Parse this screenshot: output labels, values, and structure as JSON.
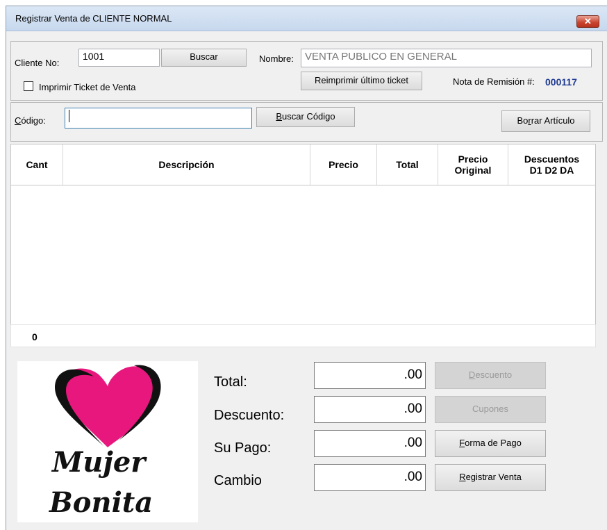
{
  "window": {
    "title": "Registrar Venta de CLIENTE NORMAL",
    "close_symbol": "✕"
  },
  "customer": {
    "client_no_label": "Cliente No:",
    "client_no_value": "1001",
    "search_button": "Buscar",
    "name_label": "Nombre:",
    "name_value": "VENTA PUBLICO EN GENERAL",
    "print_ticket_label": "Imprimir Ticket de Venta",
    "print_ticket_checked": false,
    "reprint_button": "Reimprimir último ticket",
    "note_label": "Nota de Remisión #:",
    "note_number": "000117"
  },
  "code": {
    "code_label_accel": "C",
    "code_label_rest": "ódigo:",
    "code_value": "",
    "search_code_accel": "B",
    "search_code_rest": "uscar Código",
    "delete_item_pre": "Bo",
    "delete_item_accel": "r",
    "delete_item_post": "rar Artículo"
  },
  "grid": {
    "columns": [
      {
        "key": "cant",
        "lines": [
          "Cant"
        ]
      },
      {
        "key": "descripcion",
        "lines": [
          "Descripción"
        ]
      },
      {
        "key": "precio",
        "lines": [
          "Precio"
        ]
      },
      {
        "key": "total",
        "lines": [
          "Total"
        ]
      },
      {
        "key": "precio_original",
        "lines": [
          "Precio",
          "Original"
        ]
      },
      {
        "key": "descuentos",
        "lines": [
          "Descuentos",
          "D1 D2 DA"
        ]
      }
    ],
    "rows": [],
    "footer_count": "0"
  },
  "totals": {
    "total_label": "Total:",
    "total_value": ".00",
    "discount_label": "Descuento:",
    "discount_value": ".00",
    "payment_label": "Su Pago:",
    "payment_value": ".00",
    "change_label": "Cambio",
    "change_value": ".00"
  },
  "actions": {
    "discount_accel": "D",
    "discount_rest": "escuento",
    "coupons": "Cupones",
    "payment_form_accel": "F",
    "payment_form_rest": "orma de Pago",
    "register_accel": "R",
    "register_rest": "egistrar Venta"
  },
  "logo": {
    "line1": "Mujer",
    "line2": "Bonita",
    "heart_color": "#e8177d"
  },
  "colors": {
    "note_number": "#1f3a93",
    "close_button": "#c9422d"
  }
}
